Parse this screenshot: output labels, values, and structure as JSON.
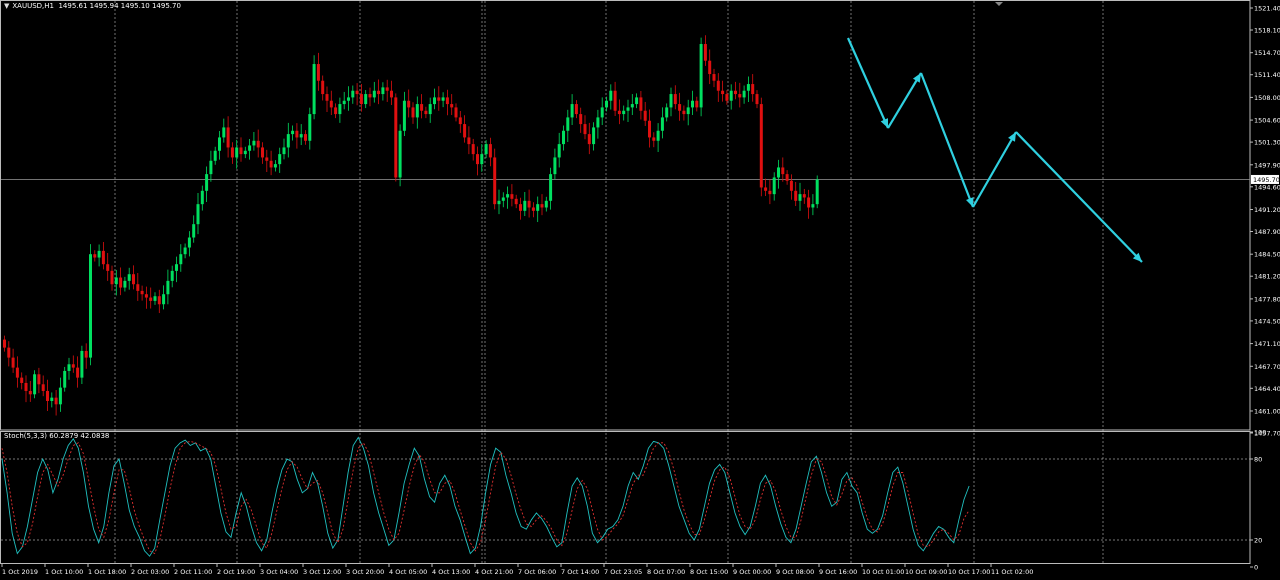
{
  "header": {
    "symbol": "XAUUSD,H1",
    "ohlc": "1495.61 1495.94 1495.10 1495.70"
  },
  "stoch_header": "Stoch(5,3,3) 60.2879 42.0838",
  "colors": {
    "background": "#000000",
    "bull": "#00e060",
    "bear": "#e01010",
    "grid": "#d8d8d8",
    "price_line": "#9a9a9a",
    "arrows": "#2fd0e0",
    "stoch_main": "#20c0c0",
    "stoch_signal": "#e03030"
  },
  "chart_data": [
    {
      "type": "candlestick",
      "title": "XAUUSD,H1",
      "ylim": [
        1457.7,
        1521.4
      ],
      "y_ticks": [
        "1521.40",
        "1518.10",
        "1514.70",
        "1511.40",
        "1508.00",
        "1504.60",
        "1501.30",
        "1497.90",
        "1494.60",
        "1491.20",
        "1487.90",
        "1484.50",
        "1481.20",
        "1477.80",
        "1474.50",
        "1471.10",
        "1467.70",
        "1464.40",
        "1461.00",
        "1457.70"
      ],
      "current_price": "1495.70",
      "x_ticks": [
        "1 Oct 2019",
        "1 Oct 10:00",
        "1 Oct 18:00",
        "2 Oct 03:00",
        "2 Oct 11:00",
        "2 Oct 19:00",
        "3 Oct 04:00",
        "3 Oct 12:00",
        "3 Oct 20:00",
        "4 Oct 05:00",
        "4 Oct 13:00",
        "4 Oct 21:00",
        "7 Oct 06:00",
        "7 Oct 14:00",
        "7 Oct 23:05",
        "8 Oct 07:00",
        "8 Oct 15:00",
        "9 Oct 00:00",
        "9 Oct 08:00",
        "9 Oct 16:00",
        "10 Oct 01:00",
        "10 Oct 09:00",
        "10 Oct 17:00",
        "11 Oct 02:00"
      ],
      "candles_close": [
        1470.5,
        1469.0,
        1467.5,
        1466.0,
        1465.2,
        1464.0,
        1463.5,
        1466.5,
        1465.0,
        1464.0,
        1462.5,
        1463.0,
        1462.0,
        1464.5,
        1467.0,
        1468.0,
        1467.5,
        1466.0,
        1470.0,
        1469.0,
        1484.5,
        1484.0,
        1485.0,
        1483.0,
        1482.0,
        1480.0,
        1481.0,
        1479.5,
        1480.5,
        1481.5,
        1480.0,
        1479.0,
        1478.5,
        1478.0,
        1477.5,
        1478.2,
        1477.0,
        1478.5,
        1480.5,
        1482.0,
        1483.0,
        1484.5,
        1485.5,
        1487.0,
        1489.0,
        1492.0,
        1494.0,
        1496.5,
        1498.5,
        1500.0,
        1502.0,
        1503.5,
        1500.5,
        1499.0,
        1500.5,
        1499.5,
        1500.0,
        1500.8,
        1501.5,
        1500.5,
        1499.0,
        1498.5,
        1497.5,
        1498.0,
        1499.5,
        1500.5,
        1502.5,
        1503.0,
        1502.0,
        1502.5,
        1501.5,
        1505.5,
        1513.0,
        1510.5,
        1508.5,
        1507.5,
        1506.5,
        1505.5,
        1507.0,
        1507.5,
        1508.0,
        1509.0,
        1508.5,
        1507.0,
        1508.5,
        1508.0,
        1509.0,
        1508.5,
        1509.5,
        1509.0,
        1508.0,
        1496.0,
        1503.0,
        1507.5,
        1506.5,
        1505.0,
        1507.0,
        1506.0,
        1505.5,
        1507.0,
        1508.0,
        1507.5,
        1508.0,
        1507.0,
        1506.5,
        1505.0,
        1504.0,
        1502.0,
        1501.0,
        1499.5,
        1498.0,
        1499.5,
        1501.0,
        1499.0,
        1492.0,
        1492.5,
        1493.0,
        1493.5,
        1492.8,
        1492.0,
        1491.0,
        1492.5,
        1491.5,
        1491.0,
        1492.0,
        1491.5,
        1492.5,
        1496.5,
        1499.0,
        1501.0,
        1503.0,
        1505.0,
        1507.0,
        1505.5,
        1504.0,
        1502.5,
        1501.0,
        1503.5,
        1505.0,
        1506.5,
        1507.5,
        1509.0,
        1506.0,
        1505.5,
        1506.0,
        1506.5,
        1507.0,
        1508.0,
        1506.0,
        1504.5,
        1502.0,
        1501.5,
        1503.0,
        1505.0,
        1506.5,
        1508.5,
        1507.0,
        1506.0,
        1505.5,
        1506.5,
        1507.5,
        1506.5,
        1516.0,
        1513.5,
        1511.5,
        1510.5,
        1509.0,
        1508.5,
        1507.5,
        1509.0,
        1508.5,
        1508.0,
        1509.0,
        1510.0,
        1508.5,
        1507.0,
        1494.5,
        1494.0,
        1493.5,
        1496.0,
        1497.5,
        1496.5,
        1495.5,
        1494.0,
        1492.5,
        1493.5,
        1493.0,
        1491.5,
        1492.0,
        1495.7
      ],
      "overlay_arrows": "manual zigzag projection drawn on chart"
    },
    {
      "type": "line",
      "title": "Stoch(5,3,3) 60.2879 42.0838",
      "ylim": [
        0,
        100
      ],
      "y_ticks": [
        "100",
        "80",
        "20",
        "0"
      ],
      "levels": [
        80,
        20
      ],
      "series": [
        {
          "name": "Stoch(5,3,3) 60.2879",
          "values": [
            80,
            55,
            25,
            10,
            15,
            30,
            50,
            70,
            80,
            72,
            55,
            65,
            80,
            90,
            95,
            88,
            70,
            45,
            28,
            18,
            30,
            55,
            75,
            80,
            62,
            42,
            30,
            22,
            12,
            8,
            14,
            35,
            55,
            75,
            88,
            92,
            94,
            90,
            92,
            86,
            88,
            80,
            60,
            40,
            26,
            22,
            40,
            55,
            45,
            30,
            18,
            12,
            20,
            40,
            58,
            72,
            80,
            78,
            65,
            55,
            58,
            70,
            62,
            45,
            25,
            14,
            20,
            45,
            70,
            90,
            96,
            88,
            75,
            55,
            40,
            28,
            16,
            20,
            40,
            62,
            76,
            88,
            82,
            65,
            52,
            48,
            62,
            68,
            60,
            45,
            35,
            22,
            10,
            14,
            30,
            55,
            76,
            88,
            85,
            68,
            55,
            40,
            30,
            28,
            35,
            40,
            36,
            30,
            22,
            15,
            18,
            40,
            60,
            66,
            60,
            45,
            25,
            18,
            22,
            28,
            30,
            35,
            45,
            60,
            70,
            65,
            75,
            88,
            93,
            92,
            88,
            75,
            60,
            45,
            35,
            25,
            20,
            28,
            45,
            62,
            72,
            76,
            70,
            55,
            40,
            30,
            24,
            30,
            45,
            62,
            68,
            60,
            45,
            32,
            22,
            18,
            28,
            45,
            62,
            78,
            82,
            70,
            55,
            45,
            48,
            65,
            70,
            60,
            55,
            40,
            28,
            25,
            28,
            38,
            55,
            70,
            74,
            62,
            45,
            28,
            16,
            12,
            18,
            25,
            30,
            28,
            22,
            18,
            35,
            50,
            60
          ]
        },
        {
          "name": "signal 42.0838",
          "values": [
            88,
            70,
            45,
            25,
            15,
            18,
            32,
            52,
            70,
            76,
            68,
            60,
            68,
            80,
            90,
            92,
            84,
            65,
            45,
            28,
            22,
            35,
            55,
            72,
            72,
            58,
            42,
            30,
            20,
            12,
            10,
            20,
            38,
            58,
            75,
            88,
            92,
            93,
            92,
            90,
            88,
            85,
            75,
            58,
            40,
            28,
            30,
            45,
            50,
            42,
            30,
            18,
            14,
            25,
            42,
            58,
            72,
            78,
            74,
            65,
            58,
            62,
            64,
            55,
            40,
            25,
            18,
            28,
            50,
            72,
            88,
            92,
            85,
            70,
            55,
            40,
            28,
            20,
            25,
            42,
            60,
            75,
            83,
            78,
            65,
            55,
            55,
            62,
            64,
            55,
            42,
            30,
            18,
            12,
            18,
            35,
            55,
            75,
            85,
            80,
            68,
            54,
            42,
            32,
            30,
            35,
            38,
            34,
            28,
            20,
            16,
            25,
            42,
            58,
            64,
            58,
            42,
            28,
            20,
            23,
            28,
            32,
            38,
            50,
            62,
            68,
            68,
            78,
            88,
            92,
            92,
            85,
            72,
            56,
            42,
            32,
            24,
            24,
            35,
            50,
            64,
            72,
            74,
            66,
            52,
            38,
            30,
            28,
            35,
            50,
            62,
            64,
            56,
            42,
            30,
            22,
            22,
            35,
            52,
            68,
            80,
            78,
            66,
            52,
            46,
            54,
            64,
            66,
            60,
            48,
            36,
            28,
            26,
            32,
            45,
            60,
            70,
            70,
            56,
            40,
            24,
            16,
            15,
            20,
            26,
            28,
            25,
            20,
            24,
            36,
            42
          ]
        }
      ],
      "x_ticks": [
        "1 Oct 2019",
        "1 Oct 10:00",
        "1 Oct 18:00",
        "2 Oct 03:00",
        "2 Oct 11:00",
        "2 Oct 19:00",
        "3 Oct 04:00",
        "3 Oct 12:00",
        "3 Oct 20:00",
        "4 Oct 05:00",
        "4 Oct 13:00",
        "4 Oct 21:00",
        "7 Oct 06:00",
        "7 Oct 14:00",
        "7 Oct 23:05",
        "8 Oct 07:00",
        "8 Oct 15:00",
        "9 Oct 00:00",
        "9 Oct 08:00",
        "9 Oct 16:00",
        "10 Oct 01:00",
        "10 Oct 09:00",
        "10 Oct 17:00",
        "11 Oct 02:00"
      ]
    }
  ]
}
